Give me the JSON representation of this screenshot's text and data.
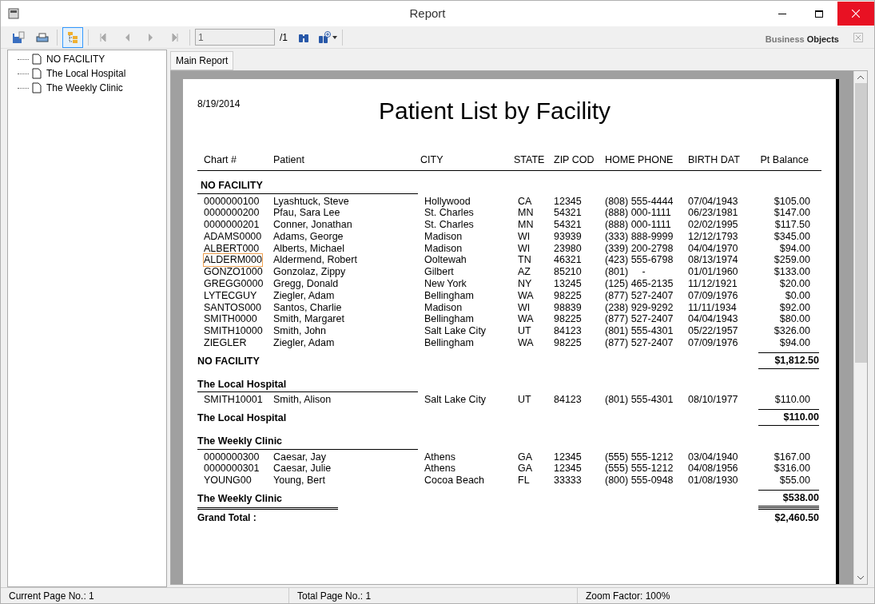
{
  "window": {
    "title": "Report"
  },
  "toolbar": {
    "group_tree_on": true,
    "page_field": "1",
    "page_total": "/1",
    "logo": {
      "first": "Business",
      "second": "Objects"
    }
  },
  "group_tree": [
    {
      "label": "NO FACILITY"
    },
    {
      "label": "The Local Hospital"
    },
    {
      "label": "The Weekly Clinic"
    }
  ],
  "tabs": [
    {
      "label": "Main Report",
      "selected": true
    }
  ],
  "report": {
    "date": "8/19/2014",
    "title": "Patient List by Facility",
    "columns": [
      "Chart #",
      "Patient",
      "CITY",
      "STATE",
      "ZIP COD",
      "HOME PHONE",
      "BIRTH DAT",
      "Pt Balance"
    ],
    "groups": [
      {
        "name": "NO FACILITY",
        "footer_name": "NO FACILITY",
        "total": "$1,812.50",
        "rows": [
          {
            "cells": [
              "0000000100",
              "Lyashtuck, Steve",
              "Hollywood",
              "CA",
              "12345",
              "(808) 555-4444",
              "07/04/1943",
              "$105.00"
            ],
            "focused": false
          },
          {
            "cells": [
              "0000000200",
              "Pfau, Sara Lee",
              "St. Charles",
              "MN",
              "54321",
              "(888) 000-1111",
              "06/23/1981",
              "$147.00"
            ],
            "focused": false
          },
          {
            "cells": [
              "0000000201",
              "Conner, Jonathan",
              "St. Charles",
              "MN",
              "54321",
              "(888) 000-1111",
              "02/02/1995",
              "$117.50"
            ],
            "focused": false
          },
          {
            "cells": [
              "ADAMS0000",
              "Adams, George",
              "Madison",
              "WI",
              "93939",
              "(333) 888-9999",
              "12/12/1793",
              "$345.00"
            ],
            "focused": false
          },
          {
            "cells": [
              "ALBERT000",
              "Alberts, Michael",
              "Madison",
              "WI",
              "23980",
              "(339) 200-2798",
              "04/04/1970",
              "$94.00"
            ],
            "focused": false
          },
          {
            "cells": [
              "ALDERM000",
              "Aldermend, Robert",
              "Ooltewah",
              "TN",
              "46321",
              "(423) 555-6798",
              "08/13/1974",
              "$259.00"
            ],
            "focused": true
          },
          {
            "cells": [
              "GONZO1000",
              "Gonzolaz, Zippy",
              "Gilbert",
              "AZ",
              "85210",
              "(801)     -",
              "01/01/1960",
              "$133.00"
            ],
            "focused": false
          },
          {
            "cells": [
              "GREGG0000",
              "Gregg, Donald",
              "New York",
              "NY",
              "13245",
              "(125) 465-2135",
              "11/12/1921",
              "$20.00"
            ],
            "focused": false
          },
          {
            "cells": [
              "LYTECGUY",
              "Ziegler, Adam",
              "Bellingham",
              "WA",
              "98225",
              "(877) 527-2407",
              "07/09/1976",
              "$0.00"
            ],
            "focused": false
          },
          {
            "cells": [
              "SANTOS000",
              "Santos, Charlie",
              "Madison",
              "WI",
              "98839",
              "(238) 929-9292",
              "11/11/1934",
              "$92.00"
            ],
            "focused": false
          },
          {
            "cells": [
              "SMITH0000",
              "Smith, Margaret",
              "Bellingham",
              "WA",
              "98225",
              "(877) 527-2407",
              "04/04/1943",
              "$80.00"
            ],
            "focused": false
          },
          {
            "cells": [
              "SMITH10000",
              "Smith, John",
              "Salt Lake City",
              "UT",
              "84123",
              "(801) 555-4301",
              "05/22/1957",
              "$326.00"
            ],
            "focused": false
          },
          {
            "cells": [
              "ZIEGLER",
              "Ziegler, Adam",
              "Bellingham",
              "WA",
              "98225",
              "(877) 527-2407",
              "07/09/1976",
              "$94.00"
            ],
            "focused": false
          }
        ]
      },
      {
        "name": "The Local Hospital",
        "footer_name": "The Local Hospital",
        "total": "$110.00",
        "rows": [
          {
            "cells": [
              "SMITH10001",
              "Smith, Alison",
              "Salt Lake City",
              "UT",
              "84123",
              "(801) 555-4301",
              "08/10/1977",
              "$110.00"
            ],
            "focused": false
          }
        ]
      },
      {
        "name": "The Weekly Clinic",
        "footer_name": "The Weekly Clinic",
        "total": "$538.00",
        "rows": [
          {
            "cells": [
              "0000000300",
              "Caesar, Jay",
              "Athens",
              "GA",
              "12345",
              "(555) 555-1212",
              "03/04/1940",
              "$167.00"
            ],
            "focused": false
          },
          {
            "cells": [
              "0000000301",
              "Caesar, Julie",
              "Athens",
              "GA",
              "12345",
              "(555) 555-1212",
              "04/08/1956",
              "$316.00"
            ],
            "focused": false
          },
          {
            "cells": [
              "YOUNG00",
              "Young, Bert",
              "Cocoa Beach",
              "FL",
              "33333",
              "(800) 555-0948",
              "01/08/1930",
              "$55.00"
            ],
            "focused": false
          }
        ]
      }
    ],
    "grand_total": {
      "label": "Grand Total :",
      "value": "$2,460.50"
    }
  },
  "status_bar": [
    "Current Page No.: 1",
    "Total Page No.: 1",
    "Zoom Factor: 100%"
  ]
}
